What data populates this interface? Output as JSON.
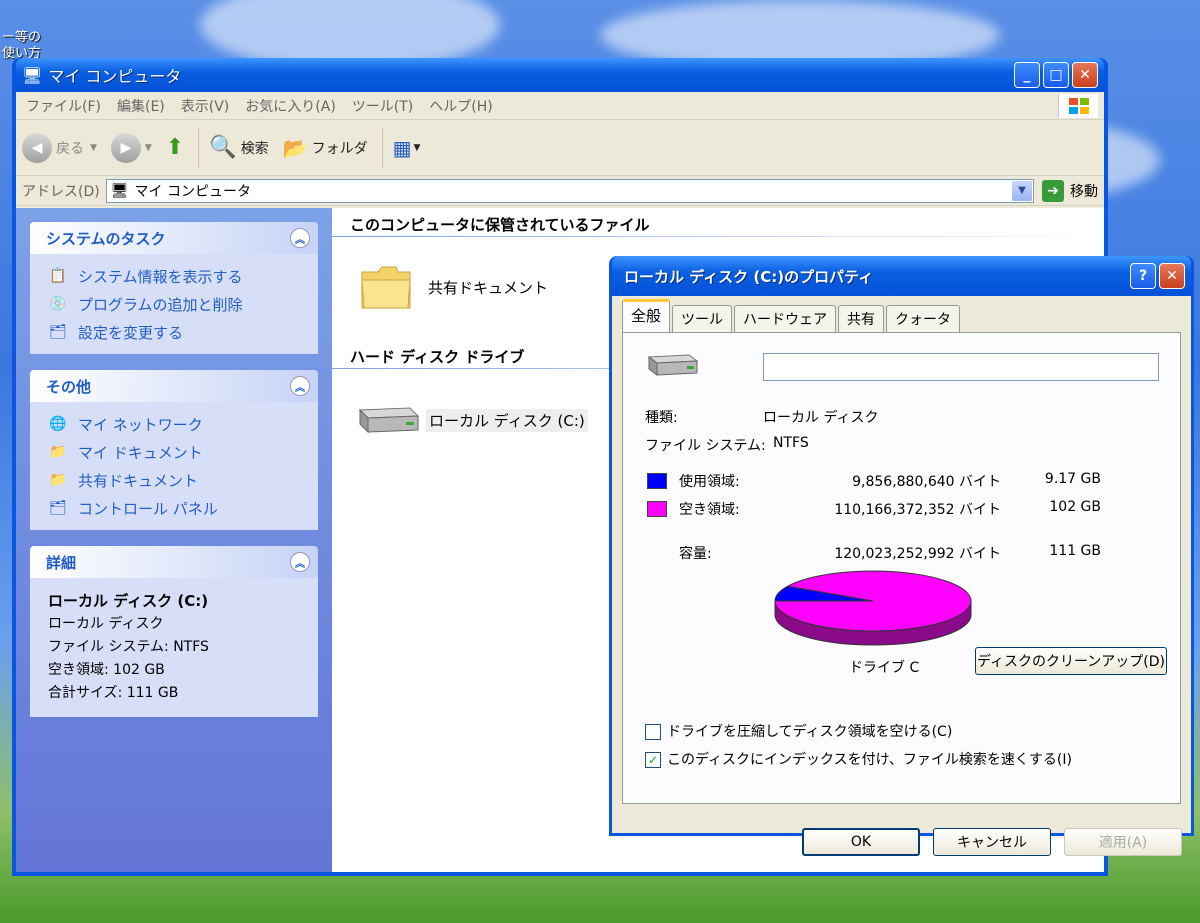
{
  "desktop": {
    "top_icon_text": [
      "ー等の",
      "使い方"
    ]
  },
  "explorer": {
    "title": "マイ コンピュータ",
    "menu": [
      "ファイル(F)",
      "編集(E)",
      "表示(V)",
      "お気に入り(A)",
      "ツール(T)",
      "ヘルプ(H)"
    ],
    "toolbar": {
      "back": "戻る",
      "search": "検索",
      "folders": "フォルダ"
    },
    "address": {
      "label": "アドレス(D)",
      "value": "マイ コンピュータ",
      "go": "移動"
    },
    "task_panes": {
      "system": {
        "title": "システムのタスク",
        "items": [
          "システム情報を表示する",
          "プログラムの追加と削除",
          "設定を変更する"
        ]
      },
      "other": {
        "title": "その他",
        "items": [
          "マイ ネットワーク",
          "マイ ドキュメント",
          "共有ドキュメント",
          "コントロール パネル"
        ]
      },
      "details": {
        "title": "詳細",
        "name": "ローカル ディスク (C:)",
        "type": "ローカル ディスク",
        "fs": "ファイル システム: NTFS",
        "free": "空き領域: 102 GB",
        "total": "合計サイズ: 111 GB"
      }
    },
    "groups": {
      "stored": "このコンピュータに保管されているファイル",
      "shared_docs": "共有ドキュメント",
      "hdd": "ハード ディスク ドライブ",
      "local_disk": "ローカル ディスク (C:)"
    }
  },
  "dialog": {
    "title": "ローカル ディスク (C:)のプロパティ",
    "tabs": [
      "全般",
      "ツール",
      "ハードウェア",
      "共有",
      "クォータ"
    ],
    "label_value": "",
    "type_label": "種類:",
    "type_value": "ローカル ディスク",
    "fs_label": "ファイル システム:",
    "fs_value": "NTFS",
    "used_label": "使用領域:",
    "used_bytes": "9,856,880,640 バイト",
    "used_gb": "9.17 GB",
    "free_label": "空き領域:",
    "free_bytes": "110,166,372,352 バイト",
    "free_gb": "102 GB",
    "cap_label": "容量:",
    "cap_bytes": "120,023,252,992 バイト",
    "cap_gb": "111 GB",
    "drive_label": "ドライブ C",
    "cleanup": "ディスクのクリーンアップ(D)",
    "compress": "ドライブを圧縮してディスク領域を空ける(C)",
    "index": "このディスクにインデックスを付け、ファイル検索を速くする(I)",
    "ok": "OK",
    "cancel": "キャンセル",
    "apply": "適用(A)",
    "colors": {
      "used": "#0000ff",
      "free": "#ff00ff"
    }
  },
  "chart_data": {
    "type": "pie",
    "categories": [
      "使用領域",
      "空き領域"
    ],
    "values": [
      9856880640,
      110166372352
    ]
  }
}
